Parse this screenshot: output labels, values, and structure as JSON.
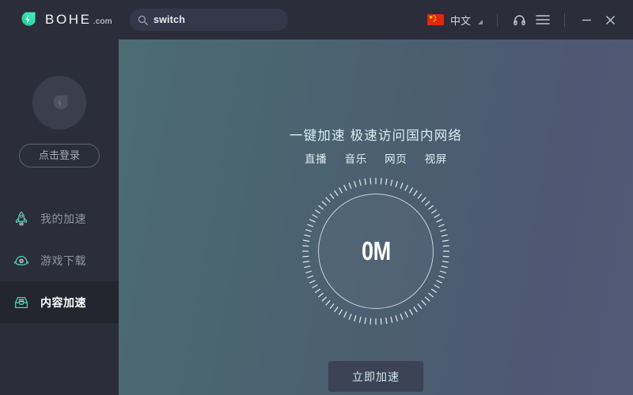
{
  "titlebar": {
    "logo_icon": "bohe-droplet-logo-icon",
    "brand_name": "BOHE",
    "brand_suffix": ".com",
    "search": {
      "icon": "search-icon",
      "value": "switch",
      "placeholder": "switch"
    },
    "language": {
      "flag_icon": "china-flag-icon",
      "label": "中文",
      "caret_icon": "dropdown-triangle-icon"
    },
    "headset_icon": "headset-support-icon",
    "menu_icon": "hamburger-menu-icon",
    "minimize_icon": "minimize-icon",
    "close_icon": "close-icon"
  },
  "sidebar": {
    "avatar_icon": "user-avatar-placeholder-icon",
    "login_label": "点击登录",
    "items": [
      {
        "icon": "rocket-icon",
        "label": "我的加速",
        "active": false
      },
      {
        "icon": "alien-ufo-icon",
        "label": "游戏下载",
        "active": false
      },
      {
        "icon": "inbox-download-icon",
        "label": "内容加速",
        "active": true
      }
    ]
  },
  "main": {
    "title": "一键加速 极速访问国内网络",
    "tags": [
      "直播",
      "音乐",
      "网页",
      "视屏"
    ],
    "gauge": {
      "value": "0M",
      "tick_count": 84
    },
    "cta_label": "立即加速"
  },
  "colors": {
    "brand_teal": "#2ee6a8",
    "sidebar_bg": "#2b2e3a",
    "active_item_bg": "#23262f",
    "main_gradient_start": "#4c6c72",
    "main_gradient_end": "#505a76",
    "accent_text": "#cfe8ea",
    "flag_red": "#de2910",
    "flag_yellow": "#ffde00"
  }
}
